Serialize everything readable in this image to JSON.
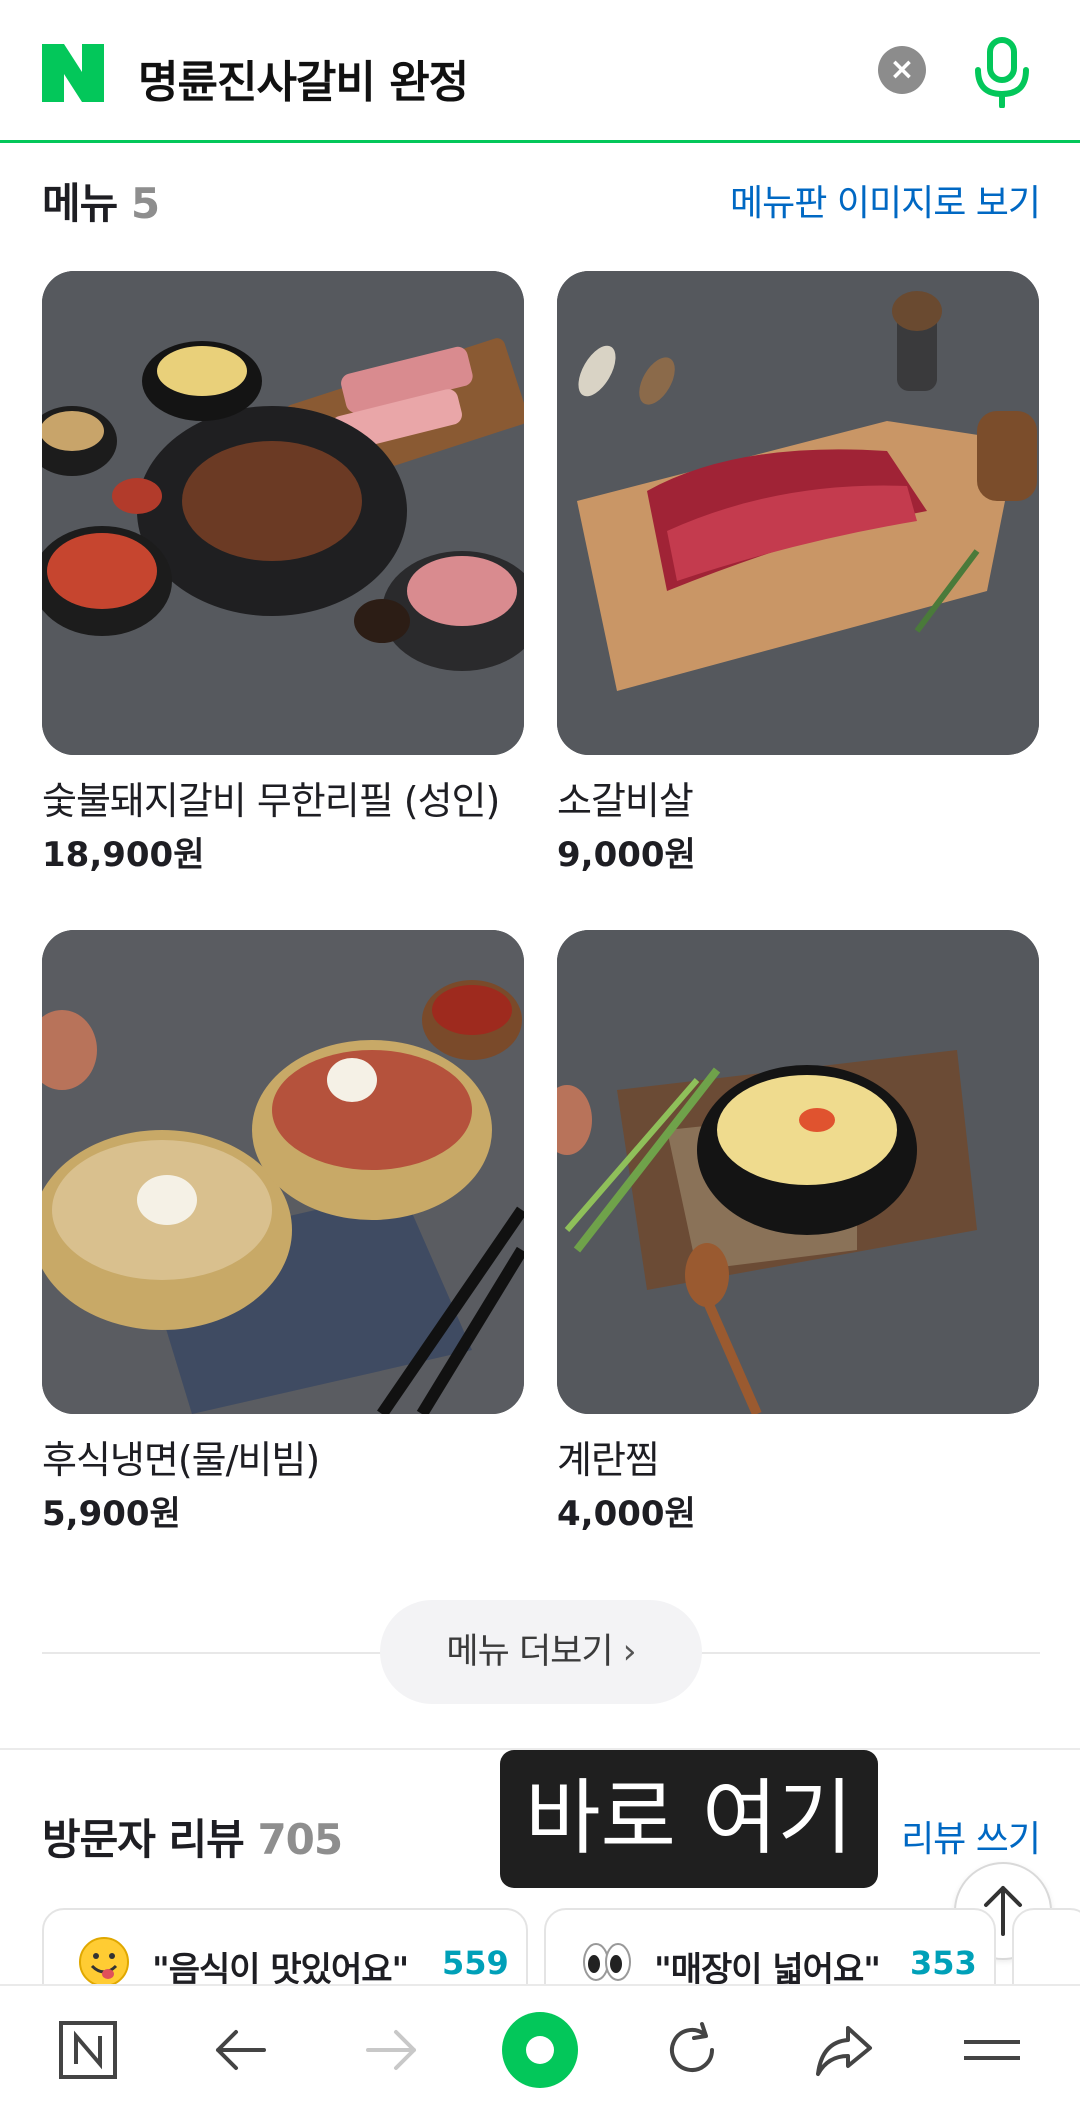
{
  "search": {
    "query": "명륜진사갈비 완정",
    "clear_label": "×"
  },
  "menu": {
    "title": "메뉴",
    "count": "5",
    "view_image_link": "메뉴판 이미지로 보기",
    "items": [
      {
        "name": "숯불돼지갈비 무한리필 (성인)",
        "price": "18,900원"
      },
      {
        "name": "소갈비살",
        "price": "9,000원"
      },
      {
        "name": "후식냉면(물/비빔)",
        "price": "5,900원"
      },
      {
        "name": "계란찜",
        "price": "4,000원"
      }
    ],
    "more_label": "메뉴 더보기",
    "more_chevron": "›"
  },
  "overlay": {
    "text": "바로 여기"
  },
  "reviews": {
    "title": "방문자 리뷰",
    "count": "705",
    "write_link": "리뷰 쓰기",
    "chips": [
      {
        "text": "\"음식이 맛있어요\"",
        "count": "559",
        "emoji": "smiley-tongue-icon"
      },
      {
        "text": "\"매장이 넓어요\"",
        "count": "353",
        "emoji": "eyes-icon"
      }
    ]
  },
  "colors": {
    "naver_green": "#03c75a",
    "link_blue": "#0068c3",
    "count_teal": "#00a0b8"
  },
  "bottom_nav": [
    "naver-home-icon",
    "back-arrow-icon",
    "forward-arrow-icon",
    "green-dot-icon",
    "refresh-icon",
    "share-icon",
    "menu-icon"
  ]
}
